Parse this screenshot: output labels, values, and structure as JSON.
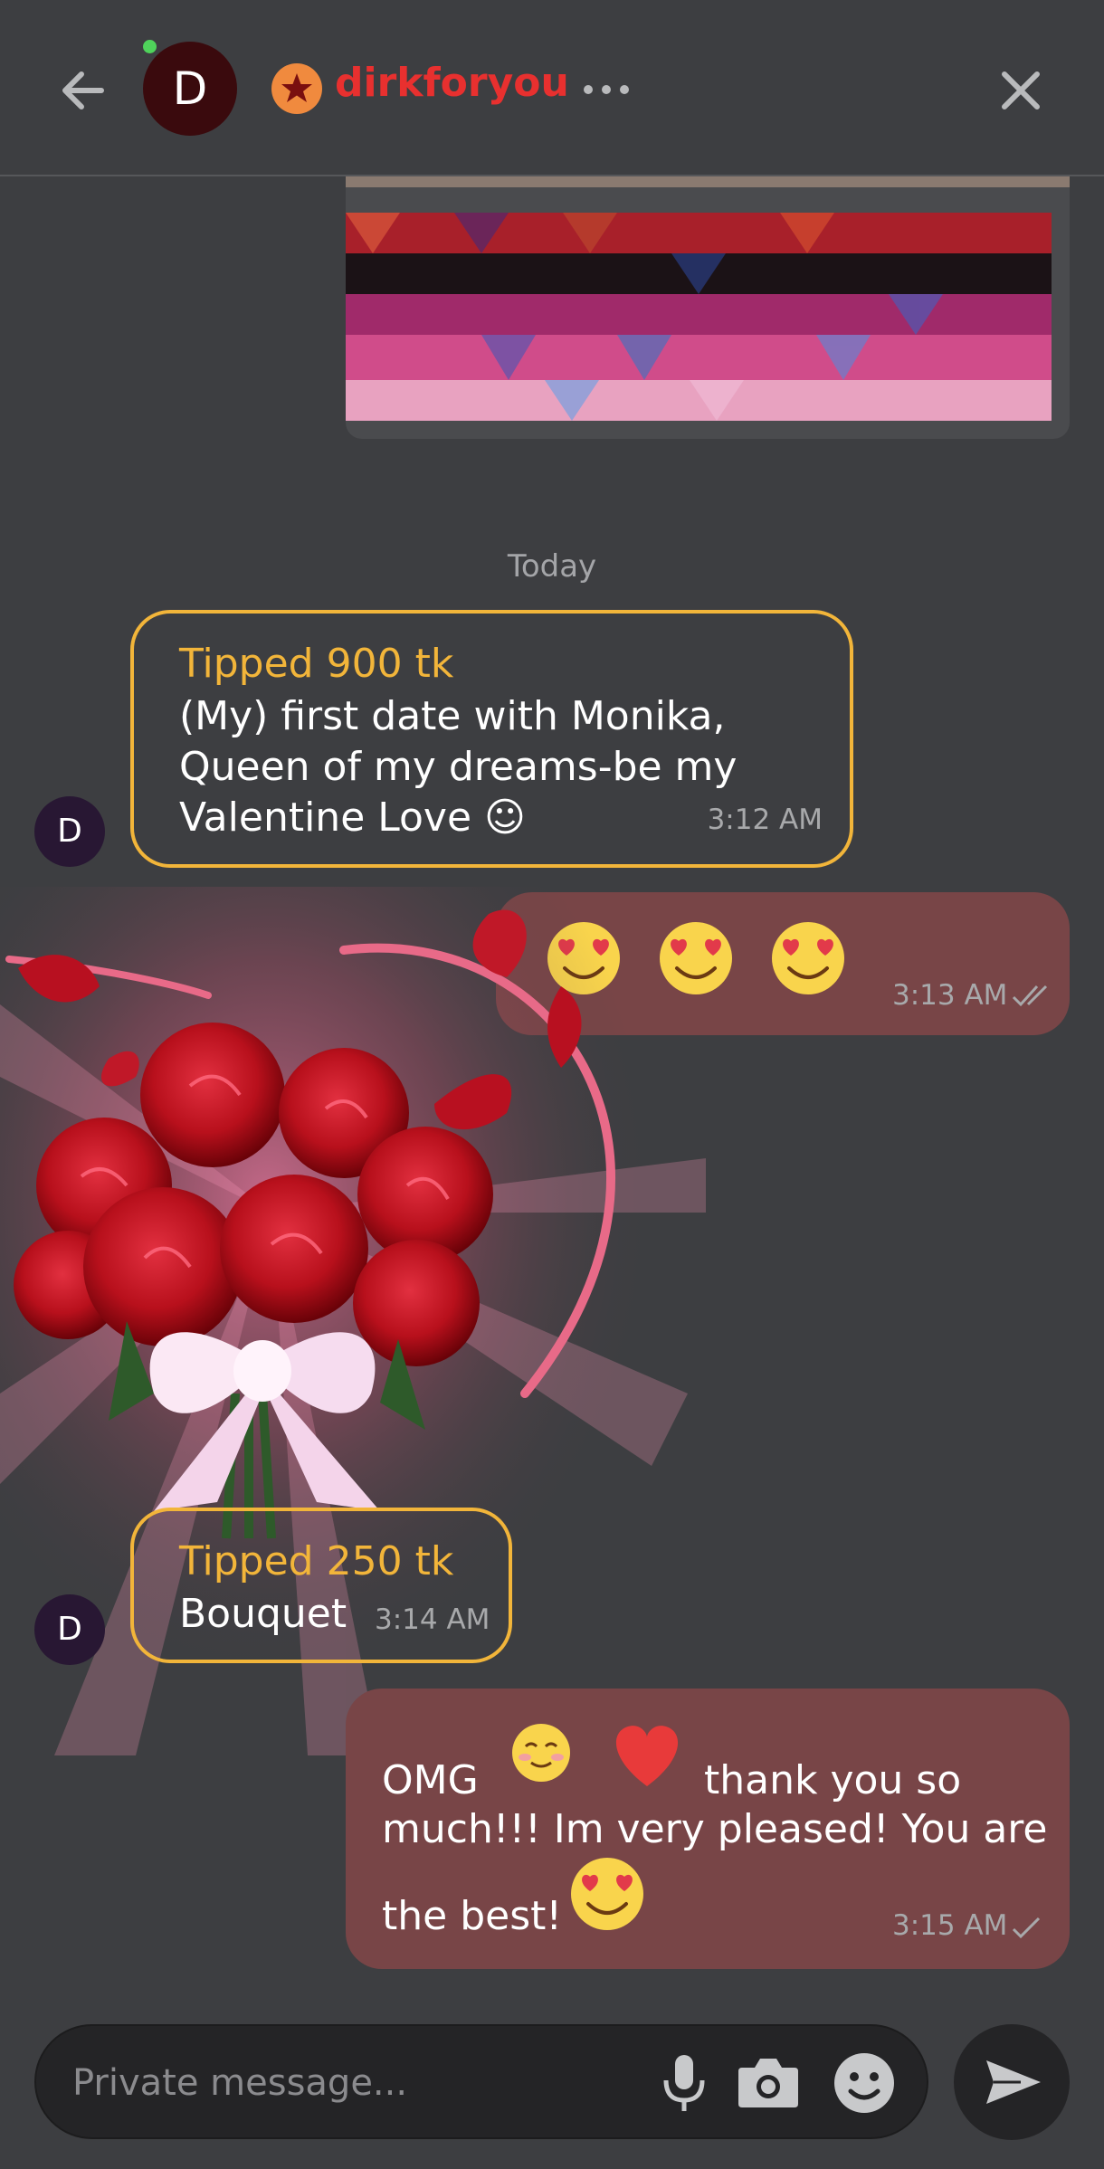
{
  "header": {
    "avatar_letter": "D",
    "username": "dirkforyou"
  },
  "chat": {
    "date_separator": "Today",
    "messages": [
      {
        "type": "tip",
        "tip_label": "Tipped 900 tk",
        "text_lines": [
          "(My) first date with Monika,",
          "Queen of my dreams-be my",
          "Valentine Love ☺"
        ],
        "time": "3:12 AM",
        "avatar_letter": "D"
      },
      {
        "type": "outgoing",
        "emojis": [
          "heart-eyes-emoji",
          "heart-eyes-emoji",
          "heart-eyes-emoji"
        ],
        "time": "3:13 AM",
        "status": "read"
      },
      {
        "type": "tip",
        "tip_label": "Tipped 250 tk",
        "text": "Bouquet",
        "time": "3:14 AM",
        "avatar_letter": "D"
      },
      {
        "type": "outgoing",
        "text_part1": "OMG",
        "text_part2": "thank you so",
        "text_part3": "much!!! Im very pleased! You are",
        "text_part4": "the best!",
        "time": "3:15 AM",
        "status": "sent"
      }
    ]
  },
  "composer": {
    "placeholder": "Private message..."
  },
  "colors": {
    "accent_red": "#e8302f",
    "tip_gold": "#f2b53a",
    "outgoing_bubble": "#784547"
  }
}
